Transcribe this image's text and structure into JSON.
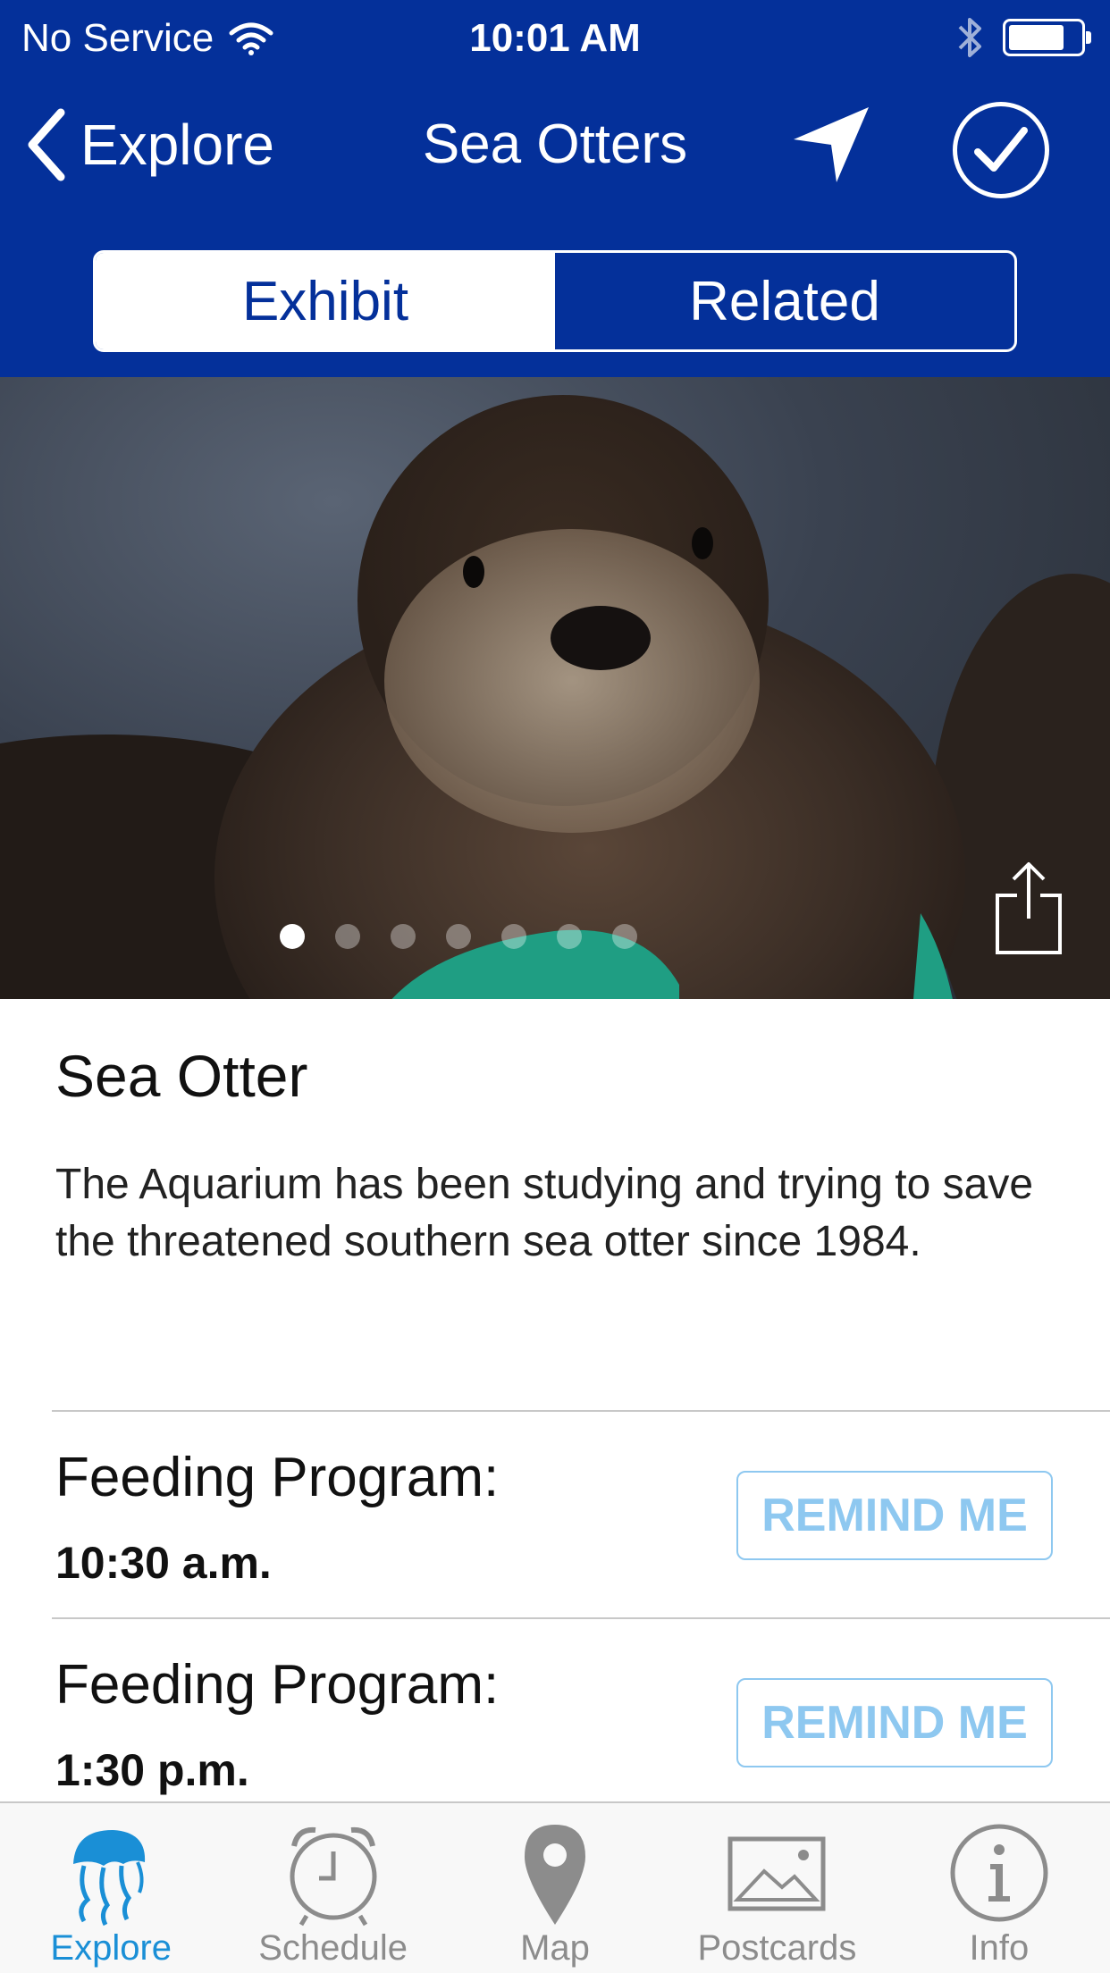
{
  "status_bar": {
    "carrier": "No Service",
    "time": "10:01 AM"
  },
  "nav": {
    "back_label": "Explore",
    "title": "Sea Otters"
  },
  "segments": [
    {
      "label": "Exhibit",
      "selected": true
    },
    {
      "label": "Related",
      "selected": false
    }
  ],
  "gallery": {
    "page_count": 7,
    "current_page": 1
  },
  "exhibit": {
    "title": "Sea Otter",
    "description": "The Aquarium has been studying and trying to save the threatened southern sea otter since 1984."
  },
  "programs": [
    {
      "label": "Feeding Program:",
      "time": "10:30 a.m.",
      "button": "REMIND ME"
    },
    {
      "label": "Feeding Program:",
      "time": "1:30 p.m.",
      "button": "REMIND ME"
    }
  ],
  "tabs": [
    {
      "label": "Explore",
      "icon": "jellyfish-icon",
      "active": true
    },
    {
      "label": "Schedule",
      "icon": "alarm-clock-icon",
      "active": false
    },
    {
      "label": "Map",
      "icon": "map-pin-icon",
      "active": false
    },
    {
      "label": "Postcards",
      "icon": "postcard-image-icon",
      "active": false
    },
    {
      "label": "Info",
      "icon": "info-icon",
      "active": false
    }
  ],
  "colors": {
    "nav_blue": "#04309a",
    "remind_blue": "#8ec8f0",
    "tab_active": "#1a8fd6",
    "tab_inactive": "#8c8c8c"
  }
}
